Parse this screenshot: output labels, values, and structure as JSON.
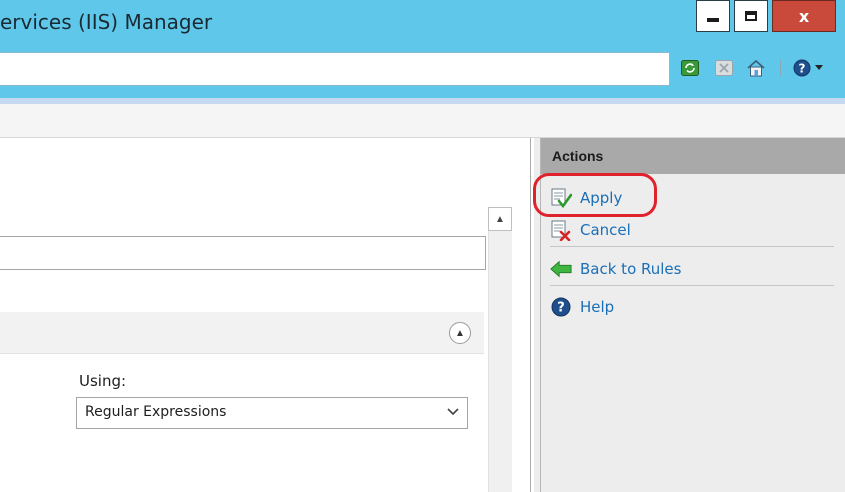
{
  "window": {
    "title": "ervices (IIS) Manager",
    "minimize_glyph": "minimize-icon",
    "maximize_glyph": "maximize-icon",
    "close_glyph": "x"
  },
  "toolbar": {
    "icons": [
      "refresh-icon",
      "stop-icon",
      "home-icon",
      "help-icon",
      "dropdown-icon"
    ]
  },
  "main": {
    "using_label": "Using:",
    "using_value": "Regular Expressions",
    "collapse_icon": "chevron-up-icon",
    "scroll_up_icon": "scroll-up-arrow-icon"
  },
  "actions": {
    "header": "Actions",
    "items": [
      {
        "label": "Apply",
        "icon": "apply-icon",
        "highlighted": true
      },
      {
        "label": "Cancel",
        "icon": "cancel-icon"
      },
      {
        "label": "Back to Rules",
        "icon": "back-arrow-icon"
      },
      {
        "label": "Help",
        "icon": "help-icon"
      }
    ]
  },
  "colors": {
    "titlebar": "#5fc8ea",
    "close_button": "#c94a3a",
    "link": "#1a6fb7",
    "actions_header": "#a9a9a9",
    "highlight": "#e0222c"
  }
}
